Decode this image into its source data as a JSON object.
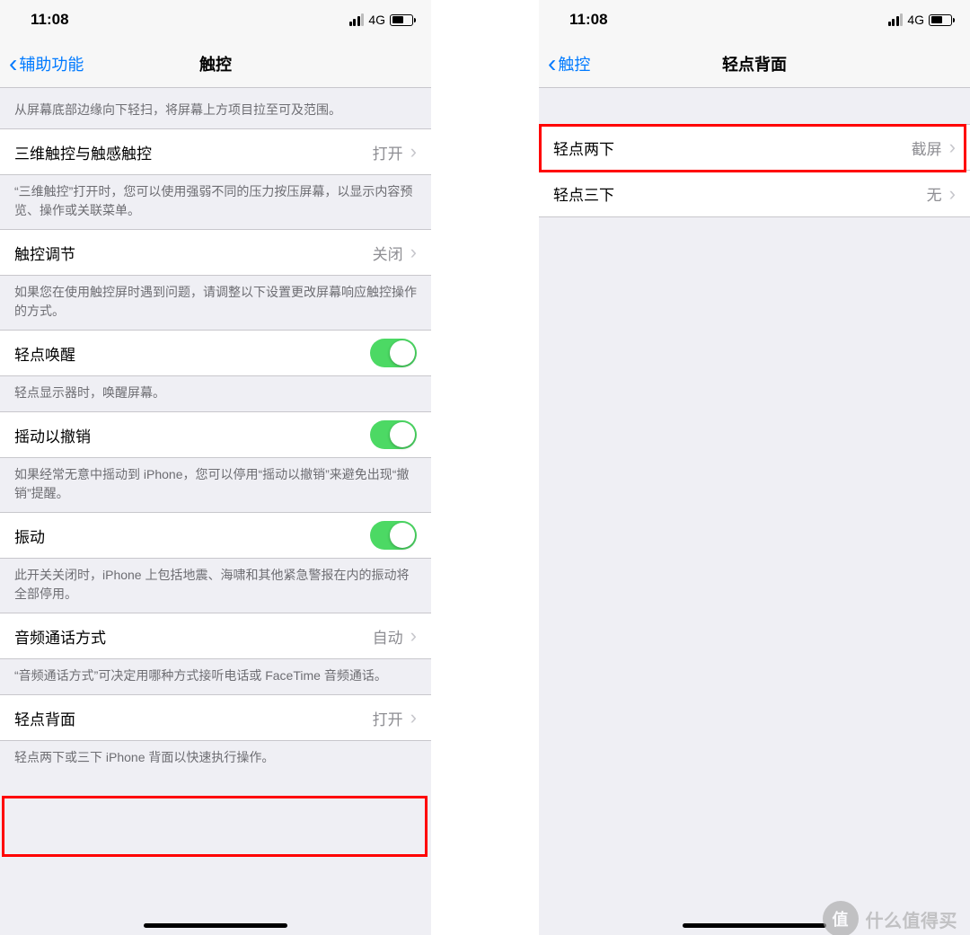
{
  "status": {
    "time": "11:08",
    "network": "4G"
  },
  "left": {
    "back_label": "辅助功能",
    "title": "触控",
    "caption_scroll": "从屏幕底部边缘向下轻扫，将屏幕上方项目拉至可及范围。",
    "row_3dtouch": {
      "label": "三维触控与触感触控",
      "value": "打开"
    },
    "caption_3dtouch": "“三维触控”打开时，您可以使用强弱不同的压力按压屏幕，以显示内容预览、操作或关联菜单。",
    "row_touch_adjust": {
      "label": "触控调节",
      "value": "关闭"
    },
    "caption_touch_adjust": "如果您在使用触控屏时遇到问题，请调整以下设置更改屏幕响应触控操作的方式。",
    "row_tap_wake": {
      "label": "轻点唤醒"
    },
    "caption_tap_wake": "轻点显示器时，唤醒屏幕。",
    "row_shake": {
      "label": "摇动以撤销"
    },
    "caption_shake": "如果经常无意中摇动到 iPhone，您可以停用“摇动以撤销”来避免出现“撤销”提醒。",
    "row_vibration": {
      "label": "振动"
    },
    "caption_vibration": "此开关关闭时，iPhone 上包括地震、海啸和其他紧急警报在内的振动将全部停用。",
    "row_audio_call": {
      "label": "音频通话方式",
      "value": "自动"
    },
    "caption_audio_call": "“音频通话方式”可决定用哪种方式接听电话或 FaceTime 音频通话。",
    "row_backtap": {
      "label": "轻点背面",
      "value": "打开"
    },
    "caption_backtap": "轻点两下或三下 iPhone 背面以快速执行操作。"
  },
  "right": {
    "back_label": "触控",
    "title": "轻点背面",
    "row_double": {
      "label": "轻点两下",
      "value": "截屏"
    },
    "row_triple": {
      "label": "轻点三下",
      "value": "无"
    }
  },
  "watermark": {
    "badge": "值",
    "text": "什么值得买"
  }
}
